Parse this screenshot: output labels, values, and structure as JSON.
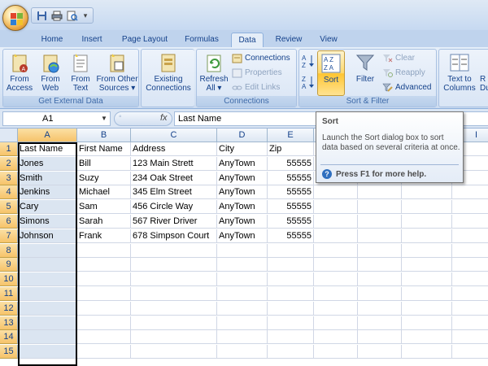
{
  "quick_access": {
    "icons": [
      "save-icon",
      "print-icon",
      "print-preview-icon"
    ],
    "dropdown_glyph": "▾"
  },
  "tabs": [
    {
      "label": "Home",
      "active": false
    },
    {
      "label": "Insert",
      "active": false
    },
    {
      "label": "Page Layout",
      "active": false
    },
    {
      "label": "Formulas",
      "active": false
    },
    {
      "label": "Data",
      "active": true
    },
    {
      "label": "Review",
      "active": false
    },
    {
      "label": "View",
      "active": false
    }
  ],
  "ribbon": {
    "get_external_data": {
      "label": "Get External Data",
      "buttons": [
        {
          "line1": "From",
          "line2": "Access"
        },
        {
          "line1": "From",
          "line2": "Web"
        },
        {
          "line1": "From",
          "line2": "Text"
        },
        {
          "line1": "From Other",
          "line2": "Sources ▾"
        },
        {
          "line1": "Existing",
          "line2": "Connections"
        }
      ]
    },
    "connections": {
      "label": "Connections",
      "refresh_line1": "Refresh",
      "refresh_line2": "All ▾",
      "connections": "Connections",
      "properties": "Properties",
      "edit_links": "Edit Links"
    },
    "sort_filter": {
      "label": "Sort & Filter",
      "sort": "Sort",
      "filter": "Filter",
      "clear": "Clear",
      "reapply": "Reapply",
      "advanced": "Advanced"
    },
    "data_tools": {
      "text_to_line1": "Text to",
      "text_to_line2": "Columns",
      "remove_line1": "R",
      "remove_line2": "Du"
    }
  },
  "formula_bar": {
    "name_box": "A1",
    "fx": "fx",
    "formula": "Last Name"
  },
  "grid": {
    "columns": [
      "A",
      "B",
      "C",
      "D",
      "E",
      "F",
      "G",
      "H",
      "I"
    ],
    "rows": [
      [
        "Last Name",
        "First Name",
        "Address",
        "City",
        "Zip"
      ],
      [
        "Jones",
        "Bill",
        "123 Main Strett",
        "AnyTown",
        "55555"
      ],
      [
        "Smith",
        "Suzy",
        "234 Oak Street",
        "AnyTown",
        "55555"
      ],
      [
        "Jenkins",
        "Michael",
        "345 Elm Street",
        "AnyTown",
        "55555"
      ],
      [
        "Cary",
        "Sam",
        "456 Circle Way",
        "AnyTown",
        "55555"
      ],
      [
        "Simons",
        "Sarah",
        "567 River Driver",
        "AnyTown",
        "55555"
      ],
      [
        "Johnson",
        "Frank",
        "678 Simpson Court",
        "AnyTown",
        "55555"
      ],
      [
        "",
        "",
        "",
        "",
        ""
      ],
      [
        "",
        "",
        "",
        "",
        ""
      ],
      [
        "",
        "",
        "",
        "",
        ""
      ],
      [
        "",
        "",
        "",
        "",
        ""
      ],
      [
        "",
        "",
        "",
        "",
        ""
      ],
      [
        "",
        "",
        "",
        "",
        ""
      ],
      [
        "",
        "",
        "",
        "",
        ""
      ],
      [
        "",
        "",
        "",
        "",
        ""
      ]
    ],
    "row_numbers": [
      "1",
      "2",
      "3",
      "4",
      "5",
      "6",
      "7",
      "8",
      "9",
      "10",
      "11",
      "12",
      "13",
      "14",
      "15"
    ]
  },
  "tooltip": {
    "title": "Sort",
    "body": "Launch the Sort dialog box to sort data based on several criteria at once.",
    "help": "Press F1 for more help."
  },
  "colors": {
    "ribbon_accent": "#15428b",
    "selected_header": "#f6c36a",
    "selected_column": "#dbe5f1"
  }
}
